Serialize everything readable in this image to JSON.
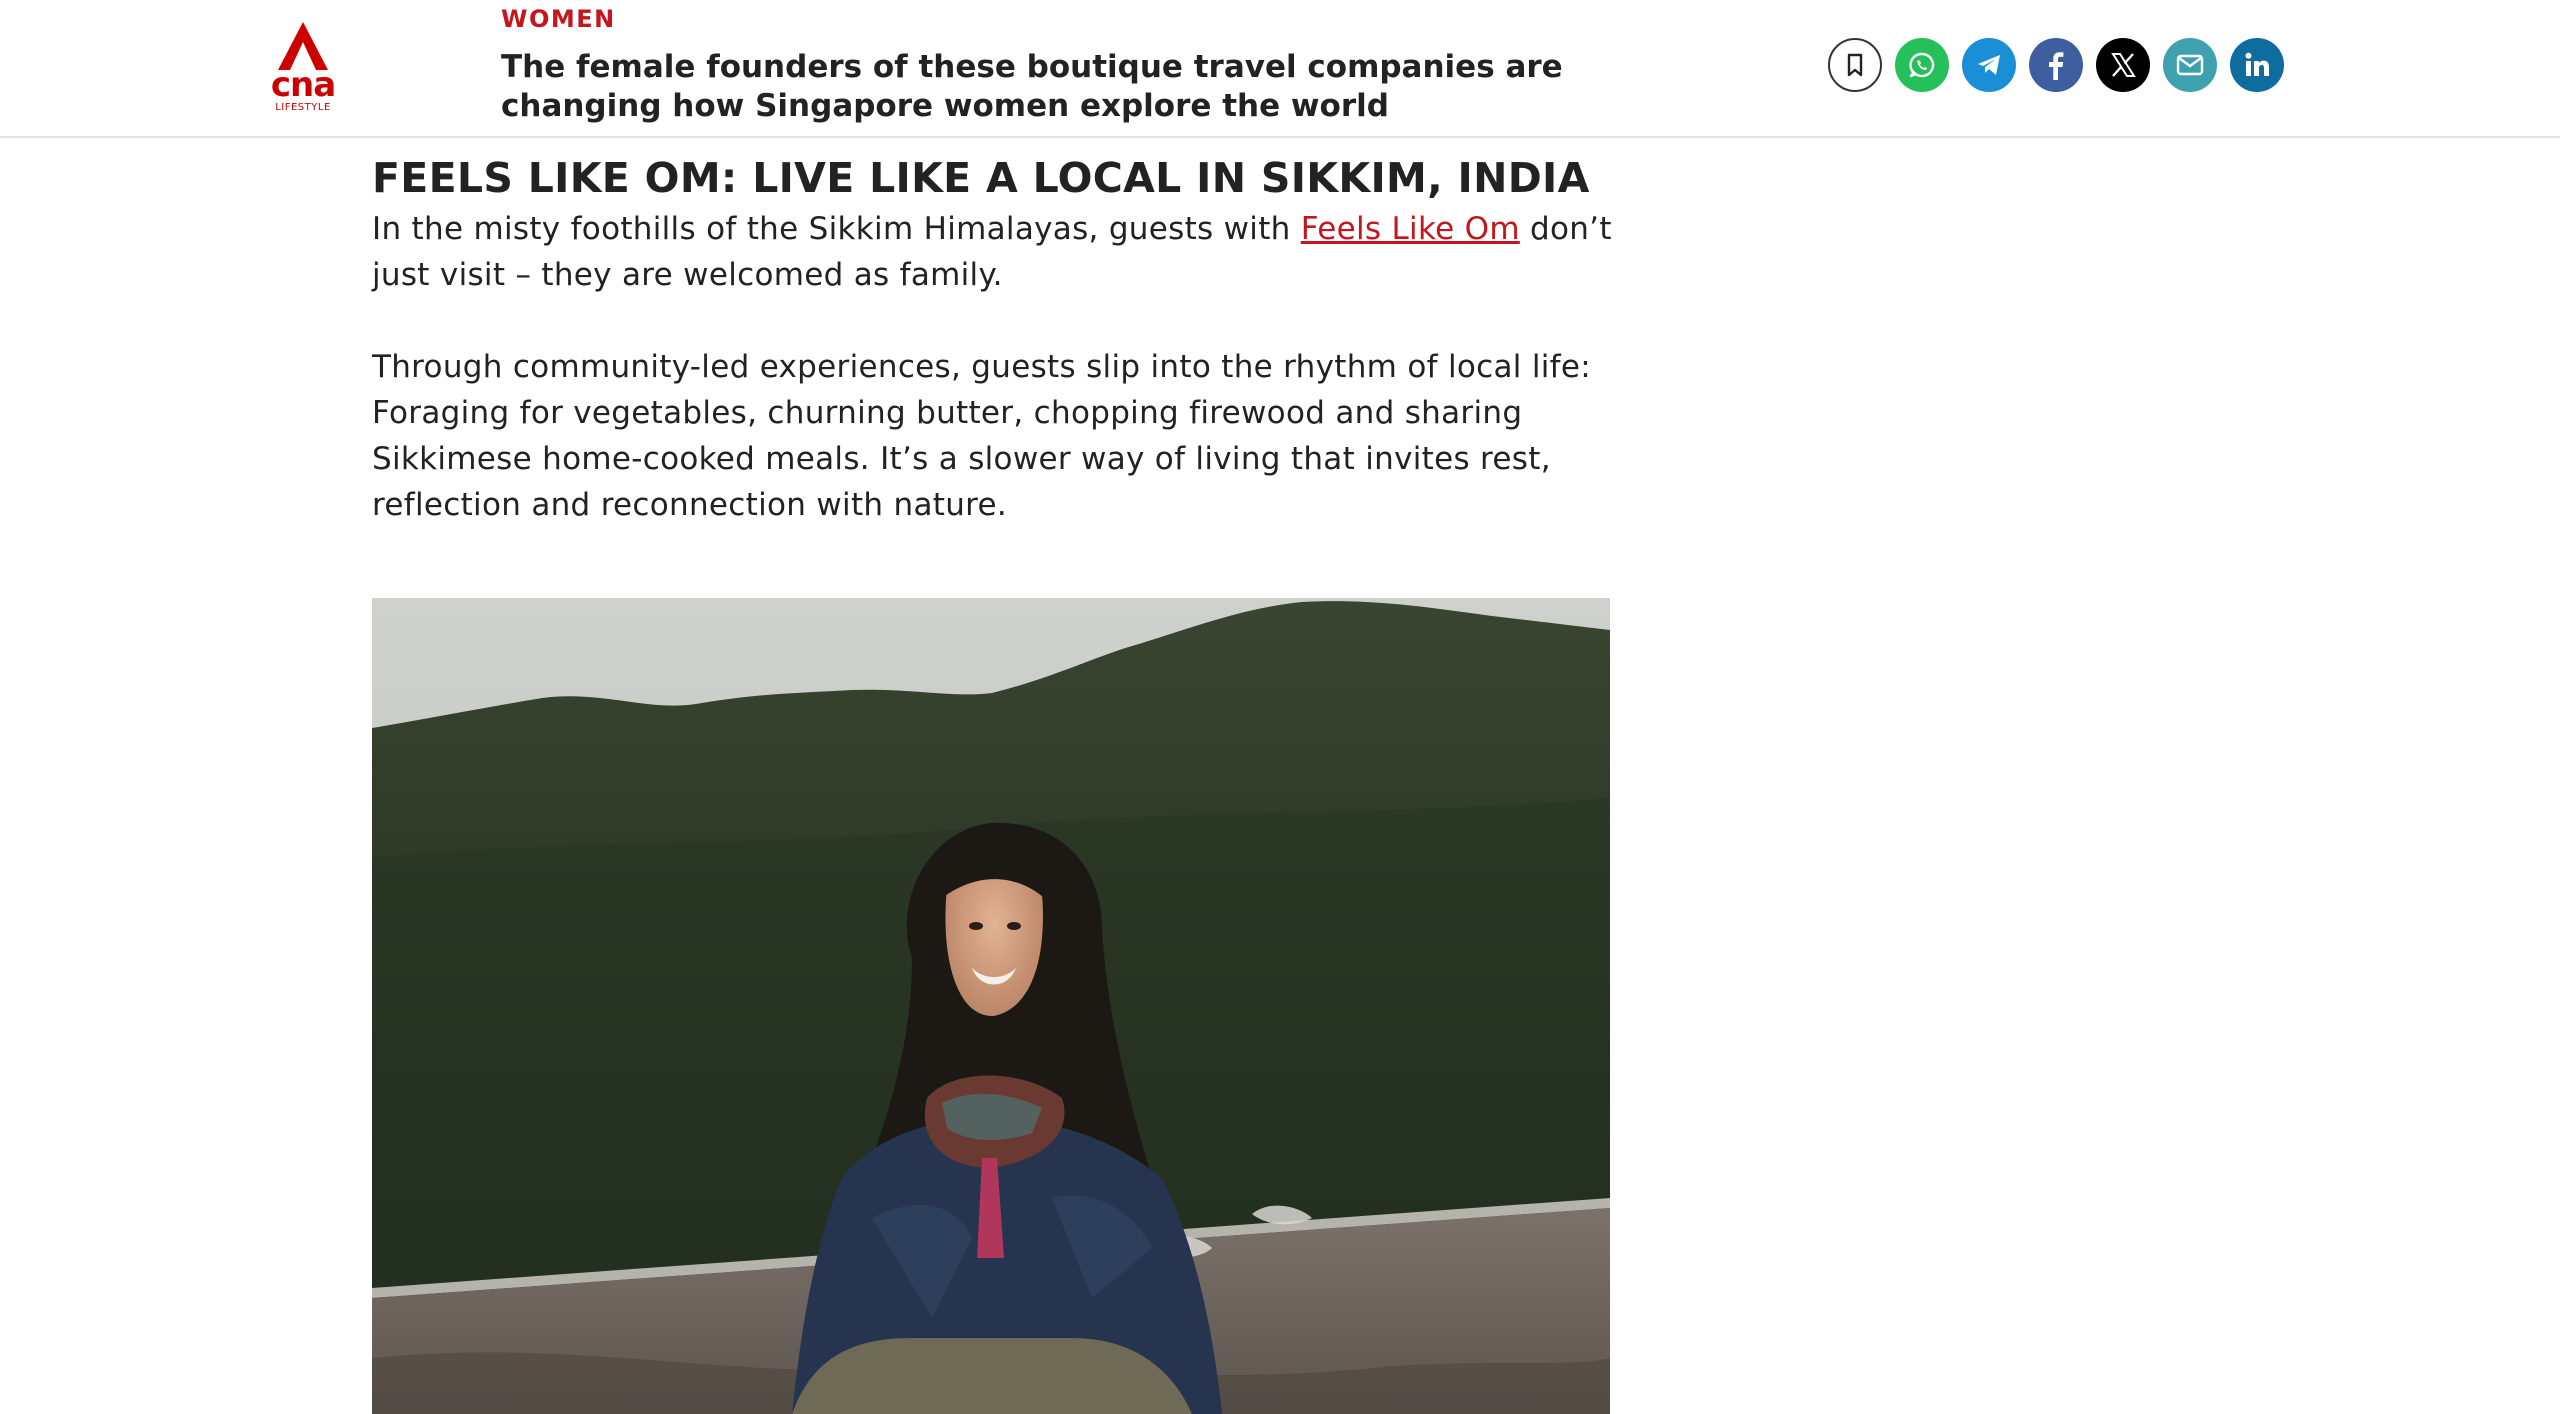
{
  "header": {
    "logo": {
      "brand": "cna",
      "sub": "LIFESTYLE",
      "icon": "cna-a-logo-icon"
    },
    "section": "WOMEN",
    "title": "The female founders of these boutique travel companies are changing how Singapore women explore the world"
  },
  "share": [
    {
      "name": "bookmark",
      "icon": "bookmark-icon",
      "color": "#ffffff"
    },
    {
      "name": "whatsapp",
      "icon": "whatsapp-icon",
      "color": "#25c05a"
    },
    {
      "name": "telegram",
      "icon": "telegram-icon",
      "color": "#1a8fd5"
    },
    {
      "name": "facebook",
      "icon": "facebook-icon",
      "color": "#3e5f9f"
    },
    {
      "name": "x",
      "icon": "x-icon",
      "color": "#000000"
    },
    {
      "name": "email",
      "icon": "email-icon",
      "color": "#3fa0b0"
    },
    {
      "name": "linkedin",
      "icon": "linkedin-icon",
      "color": "#0f6c9f"
    }
  ],
  "article": {
    "subheading": "FEELS LIKE OM: LIVE LIKE A LOCAL IN SIKKIM, INDIA",
    "para1_before": "In the misty foothills of the Sikkim Himalayas, guests with ",
    "para1_link": "Feels Like Om",
    "para1_after": " don’t just visit – they are welcomed as family.",
    "para2": "Through community-led experiences, guests slip into the rhythm of local life: Foraging for vegetables, churning butter, chopping firewood and sharing Sikkimese home-cooked meals. It’s a slower way of living that invites rest, reflection and reconnection with nature."
  },
  "colors": {
    "accent": "#c4161c",
    "brand": "#cc0000"
  }
}
